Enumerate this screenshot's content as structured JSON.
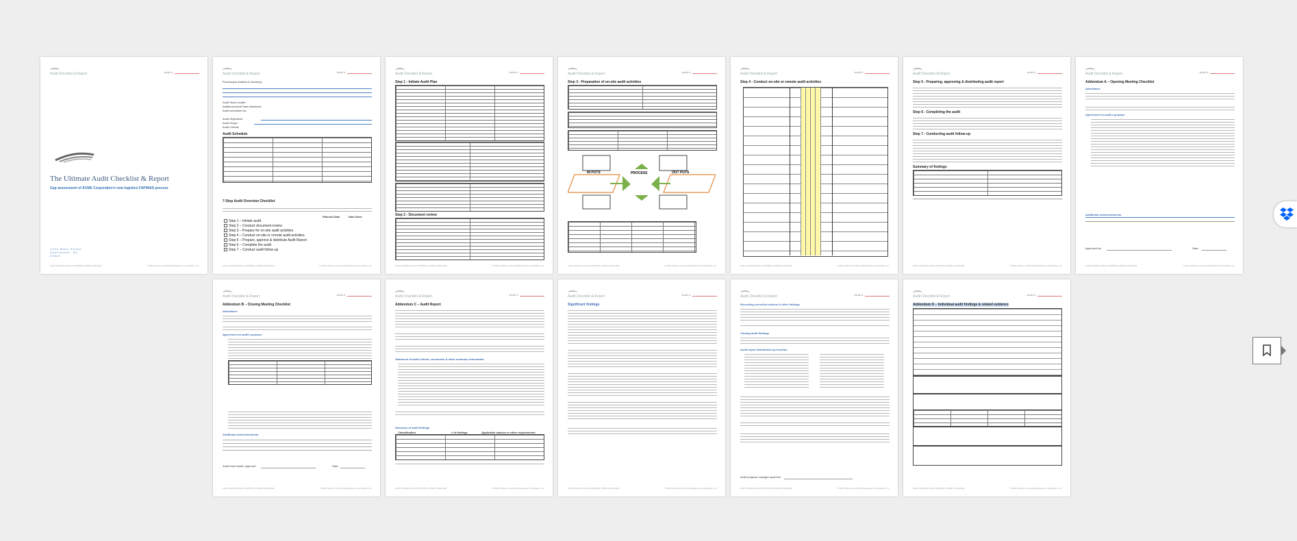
{
  "document": {
    "header_title": "Audit Checklist & Report",
    "header_audit_label": "Audit #:",
    "footer_left": "Audit Checklist & Report (FAP/MAS_ACME Confidential)",
    "footer_right": "© 2023 Institute of Internal Management Consultants, Inc."
  },
  "pages": {
    "p1": {
      "title": "The Ultimate Audit Checklist & Report",
      "subtitle": "Gap assessment of ACME Corporation's new logistics FAP/MAS process",
      "address_line1": "1234 Main Street",
      "address_line2": "Charleston, SC",
      "address_line3": "29401"
    },
    "p2": {
      "auditee_label": "Process(es) Audited & Owner(s):",
      "team_leader": "Audit Team Leader:",
      "team_members": "Additional Audit Team Members:",
      "scheduled": "Audit scheduled for:",
      "objectives": "Audit Objectives:",
      "scope": "Audit Scope:",
      "criteria": "Audit Criteria:",
      "schedule_title": "Audit Schedule",
      "overview_title": "7-Step Audit Overview Checklist",
      "col_planned": "Planned Date",
      "col_done": "Date Done",
      "steps": [
        "Step 1 – Initiate audit",
        "Step 2 – Conduct document review",
        "Step 3 – Prepare for on-site audit activities",
        "Step 4 – Conduct on-site or remote audit activities",
        "Step 5 – Prepare, approve & distribute Audit Report",
        "Step 6 – Complete the audit",
        "Step 7 – Conduct audit follow-up"
      ]
    },
    "p3": {
      "title": "Step 1 - Initiate Audit Plan",
      "title2": "Step 2 - Document review"
    },
    "p4": {
      "title": "Step 3 - Preparation of on-site audit activities",
      "flow_inputs": "IN PUTS",
      "flow_process": "PROCESS",
      "flow_outputs": "OUT PUTS"
    },
    "p5": {
      "title": "Step 4 - Conduct on-site or remote audit activities"
    },
    "p6": {
      "title1": "Step 5 - Preparing, approving & distributing audit report",
      "title2": "Step 6 - Completing the audit",
      "title3": "Step 7 - Conducting audit follow-up",
      "title4": "Summary of findings"
    },
    "p7": {
      "title": "Addendum A – Opening Meeting Checklist",
      "attendance": "Attendance",
      "agreement": "Agreement on audit's purpose",
      "comments": "Additional notes/comments",
      "approved_by": "Approved by:",
      "date": "Date:"
    },
    "p8": {
      "title": "Addendum B – Closing Meeting Checklist",
      "attendance": "Attendance",
      "agreement": "Agreement on audit's purpose",
      "comments": "Additional notes/comments",
      "approval": "Audit team leader approval:",
      "date": "Date:"
    },
    "p9": {
      "title": "Addendum C – Audit Report",
      "statement": "Statement of audit criteria, conclusion & other summary information",
      "summary": "Summary of audit findings",
      "col_class": "Classification",
      "col_findings": "# of findings",
      "col_clauses": "Applicable clauses or other requirements"
    },
    "p10": {
      "title": "Significant findings"
    },
    "p11": {
      "title1": "Recording corrective actions & other findings",
      "title2": "Closing audit findings",
      "title3": "Audit report distribution by function",
      "approval": "Audit program manager approval:"
    },
    "p12": {
      "title": "Addendum D – Individual audit findings & related evidence"
    }
  }
}
